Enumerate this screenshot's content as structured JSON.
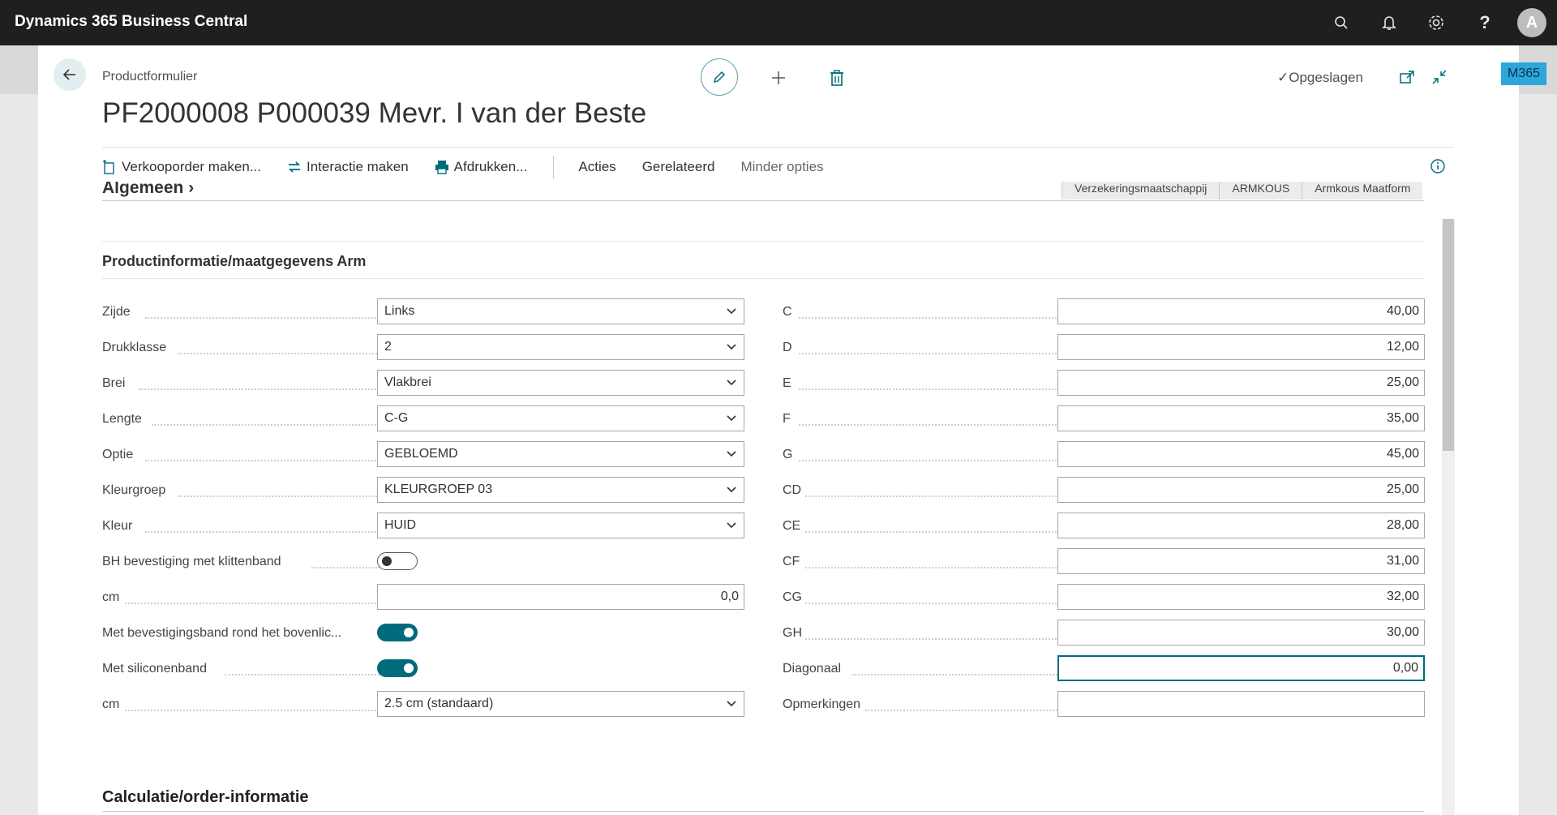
{
  "app": {
    "title": "Dynamics 365 Business Central",
    "avatar_initial": "A",
    "badge": "M365"
  },
  "page": {
    "breadcrumb": "Productformulier",
    "title": "PF2000008 P000039 Mevr. I van der Beste",
    "status": "Opgeslagen"
  },
  "actions": {
    "verkooporder": "Verkooporder maken...",
    "interactie": "Interactie maken",
    "afdrukken": "Afdrukken...",
    "acties": "Acties",
    "gerelateerd": "Gerelateerd",
    "minder": "Minder opties"
  },
  "algemeen": {
    "title": "Algemeen",
    "tabs": [
      "Verzekeringsmaatschappij",
      "ARMKOUS",
      "Armkous Maatform"
    ]
  },
  "section": {
    "title": "Productinformatie/maatgegevens Arm",
    "left": [
      {
        "label": "Zijde",
        "type": "select",
        "value": "Links"
      },
      {
        "label": "Drukklasse",
        "type": "select",
        "value": "2"
      },
      {
        "label": "Brei",
        "type": "select",
        "value": "Vlakbrei"
      },
      {
        "label": "Lengte",
        "type": "select",
        "value": "C-G"
      },
      {
        "label": "Optie",
        "type": "select",
        "value": "GEBLOEMD"
      },
      {
        "label": "Kleurgroep",
        "type": "select",
        "value": "KLEURGROEP 03"
      },
      {
        "label": "Kleur",
        "type": "select",
        "value": "HUID"
      },
      {
        "label": "BH bevestiging met klittenband",
        "type": "toggle",
        "value": "off"
      },
      {
        "label": "cm",
        "type": "number",
        "value": "0,0"
      },
      {
        "label": "Met bevestigingsband rond het bovenlic...",
        "type": "toggle",
        "value": "on"
      },
      {
        "label": "Met siliconenband",
        "type": "toggle",
        "value": "on"
      },
      {
        "label": "cm",
        "type": "select",
        "value": "2.5 cm (standaard)"
      }
    ],
    "right": [
      {
        "label": "C",
        "value": "40,00"
      },
      {
        "label": "D",
        "value": "12,00"
      },
      {
        "label": "E",
        "value": "25,00"
      },
      {
        "label": "F",
        "value": "35,00"
      },
      {
        "label": "G",
        "value": "45,00"
      },
      {
        "label": "CD",
        "value": "25,00"
      },
      {
        "label": "CE",
        "value": "28,00"
      },
      {
        "label": "CF",
        "value": "31,00"
      },
      {
        "label": "CG",
        "value": "32,00"
      },
      {
        "label": "GH",
        "value": "30,00"
      },
      {
        "label": "Diagonaal",
        "value": "0,00"
      },
      {
        "label": "Opmerkingen",
        "value": ""
      }
    ]
  },
  "section2": {
    "title": "Calculatie/order-informatie"
  },
  "colors": {
    "accent": "#006b7a",
    "appbar": "#1f1f1f"
  }
}
